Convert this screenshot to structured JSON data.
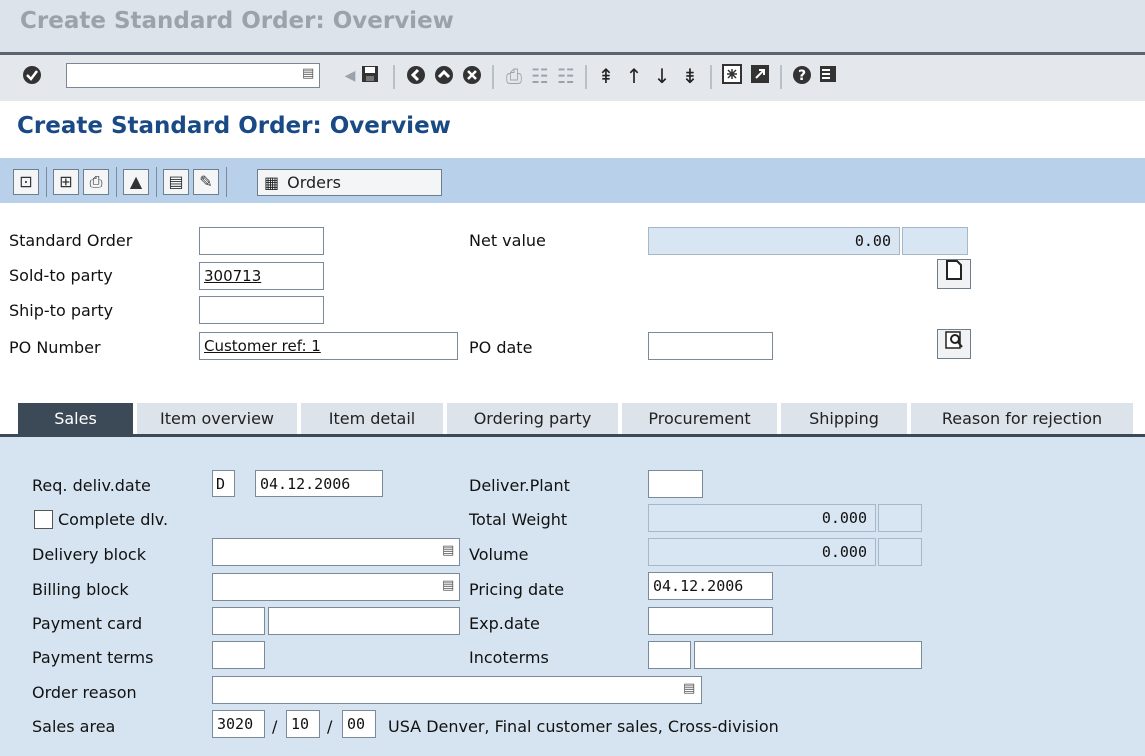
{
  "window": {
    "title": "Create Standard Order: Overview"
  },
  "system_toolbar": {
    "command_field_value": "",
    "icons": [
      "enter-icon",
      "back-icon",
      "save-icon",
      "back-nav-icon",
      "exit-icon",
      "cancel-icon",
      "print-icon",
      "find-icon",
      "find-next-icon",
      "first-page-icon",
      "previous-page-icon",
      "next-page-icon",
      "last-page-icon",
      "new-session-icon",
      "shortcut-icon",
      "help-icon",
      "layout-menu-icon"
    ]
  },
  "screen_title": "Create Standard Order: Overview",
  "app_toolbar": {
    "orders_label": "Orders"
  },
  "header": {
    "standard_order": {
      "label": "Standard Order",
      "value": ""
    },
    "net_value": {
      "label": "Net value",
      "value": "0.00",
      "currency": ""
    },
    "sold_to": {
      "label": "Sold-to party",
      "value": "300713"
    },
    "ship_to": {
      "label": "Ship-to party",
      "value": ""
    },
    "po_number": {
      "label": "PO Number",
      "value": "Customer ref: 1"
    },
    "po_date": {
      "label": "PO date",
      "value": ""
    }
  },
  "tabs": [
    {
      "label": "Sales",
      "active": true
    },
    {
      "label": "Item overview",
      "active": false
    },
    {
      "label": "Item detail",
      "active": false
    },
    {
      "label": "Ordering party",
      "active": false
    },
    {
      "label": "Procurement",
      "active": false
    },
    {
      "label": "Shipping",
      "active": false
    },
    {
      "label": "Reason for rejection",
      "active": false
    }
  ],
  "sales": {
    "req_deliv": {
      "label": "Req. deliv.date",
      "format": "D",
      "value": "04.12.2006"
    },
    "deliver_plant": {
      "label": "Deliver.Plant",
      "value": ""
    },
    "complete_dlv": {
      "label": "Complete dlv.",
      "checked": false
    },
    "total_weight": {
      "label": "Total Weight",
      "value": "0.000",
      "unit": ""
    },
    "delivery_block": {
      "label": "Delivery block",
      "value": ""
    },
    "volume": {
      "label": "Volume",
      "value": "0.000",
      "unit": ""
    },
    "billing_block": {
      "label": "Billing block",
      "value": ""
    },
    "pricing_date": {
      "label": "Pricing date",
      "value": "04.12.2006"
    },
    "payment_card": {
      "label": "Payment card",
      "value1": "",
      "value2": ""
    },
    "exp_date": {
      "label": "Exp.date",
      "value": ""
    },
    "payment_terms": {
      "label": "Payment terms",
      "value": ""
    },
    "incoterms": {
      "label": "Incoterms",
      "value1": "",
      "value2": ""
    },
    "order_reason": {
      "label": "Order reason",
      "value": ""
    },
    "sales_area": {
      "label": "Sales area",
      "org": "3020",
      "channel": "10",
      "division": "00",
      "slash1": "/",
      "slash2": "/",
      "description": "USA Denver, Final customer sales, Cross-division"
    }
  }
}
